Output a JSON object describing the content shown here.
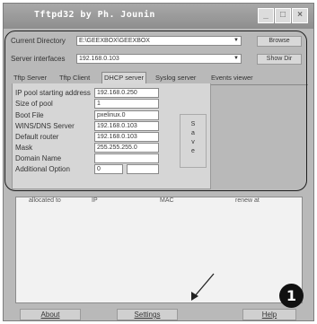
{
  "window": {
    "title": "Tftpd32 by Ph. Jounin"
  },
  "titlebar_buttons": {
    "minimize": "_",
    "maximize": "□",
    "close": "×"
  },
  "current_directory": {
    "label": "Current Directory",
    "value": "E:\\GEEXBOX\\GEEXBOX",
    "browse": "Browse"
  },
  "server_interfaces": {
    "label": "Server interfaces",
    "value": "192.168.0.103",
    "show_dir": "Show Dir"
  },
  "tabs": [
    "Tftp Server",
    "Tftp Client",
    "DHCP server",
    "Syslog server",
    "Events viewer"
  ],
  "dhcp": {
    "ip_pool_label": "IP pool starting address",
    "ip_pool_value": "192.168.0.250",
    "pool_size_label": "Size of pool",
    "pool_size_value": "1",
    "boot_file_label": "Boot File",
    "boot_file_value": "pxelinux.0",
    "wins_dns_label": "WINS/DNS Server",
    "wins_dns_value": "192.168.0.103",
    "router_label": "Default router",
    "router_value": "192.168.0.103",
    "mask_label": "Mask",
    "mask_value": "255.255.255.0",
    "domain_label": "Domain Name",
    "domain_value": "",
    "option_label": "Additional Option",
    "option_value": "0",
    "option_value2": "",
    "save_letters": [
      "S",
      "a",
      "v",
      "e"
    ]
  },
  "list_columns": [
    "allocated to",
    "IP",
    "MAC",
    "renew at"
  ],
  "bottom_buttons": {
    "about": "About",
    "settings": "Settings",
    "help": "Help"
  },
  "callout_number": "1"
}
